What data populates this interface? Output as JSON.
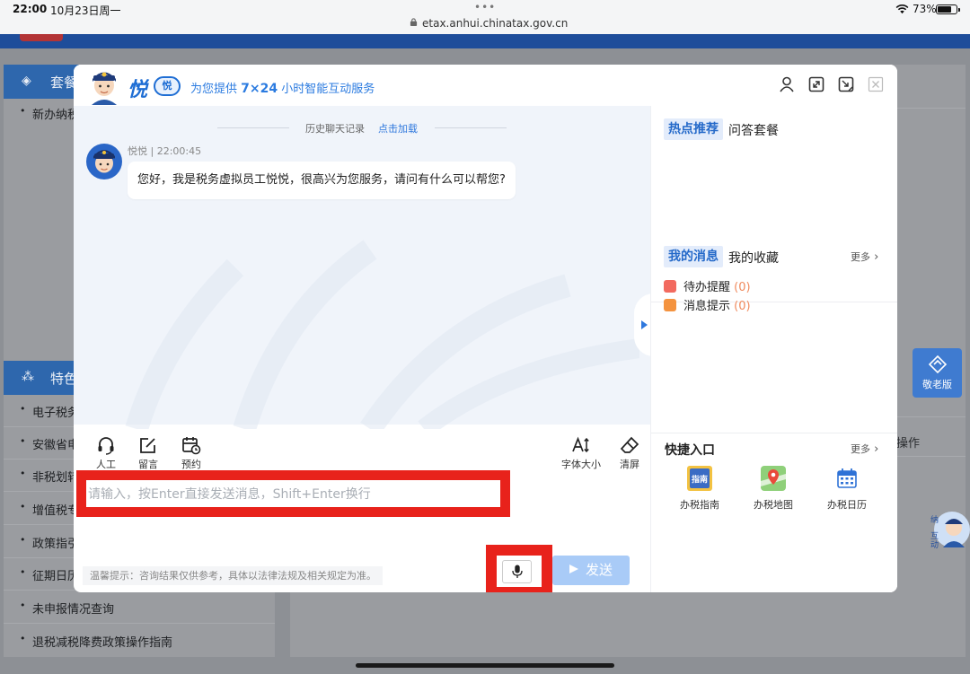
{
  "status_bar": {
    "time": "22:00",
    "date": "10月23日周一",
    "dots": "•••",
    "url": "etax.anhui.chinatax.gov.cn",
    "battery": "73%"
  },
  "background": {
    "sections": [
      {
        "label": "套餐"
      },
      {
        "label": "特色"
      }
    ],
    "items": [
      "新办纳税",
      "电子税务",
      "安徽省电",
      "非税划转",
      "增值税专",
      "政策指引",
      "征期日历",
      "未申报情况查询",
      "退税减税降费政策操作指南"
    ],
    "right_text": "操作",
    "elder_label": "敬老版",
    "float_avatar_label": "纳互动"
  },
  "dialog": {
    "logo_text": "悦",
    "logo_badge": "悦",
    "slogan_prefix": "为您提供 ",
    "slogan_bold": "7×24",
    "slogan_suffix": " 小时智能互动服务",
    "history_label": "历史聊天记录",
    "history_link": "点击加载",
    "message": {
      "sender_time": "悦悦 | 22:00:45",
      "text": "您好，我是税务虚拟员工悦悦，很高兴为您服务，请问有什么可以帮您?"
    },
    "tools": {
      "human": "人工",
      "message": "留言",
      "appointment": "预约",
      "font_size": "字体大小",
      "clear": "清屏"
    },
    "input_placeholder": "请输入，按Enter直接发送消息，Shift+Enter换行",
    "tip": "温馨提示：咨询结果仅供参考，具体以法律法规及相关规定为准。",
    "send_label": "发送",
    "side": {
      "tab_hot": "热点推荐",
      "tab_qa": "问答套餐",
      "tab_my_msg": "我的消息",
      "tab_fav": "我的收藏",
      "more": "更多",
      "todo_label": "待办提醒",
      "todo_count": "(0)",
      "notice_label": "消息提示",
      "notice_count": "(0)",
      "quick_title": "快捷入口",
      "quick_more": "更多",
      "quick_items": [
        "办税指南",
        "办税地图",
        "办税日历"
      ]
    },
    "colors": {
      "accent": "#2f78dd",
      "highlight_frame": "#e8221b",
      "send_disabled": "#a9cbf7"
    }
  }
}
